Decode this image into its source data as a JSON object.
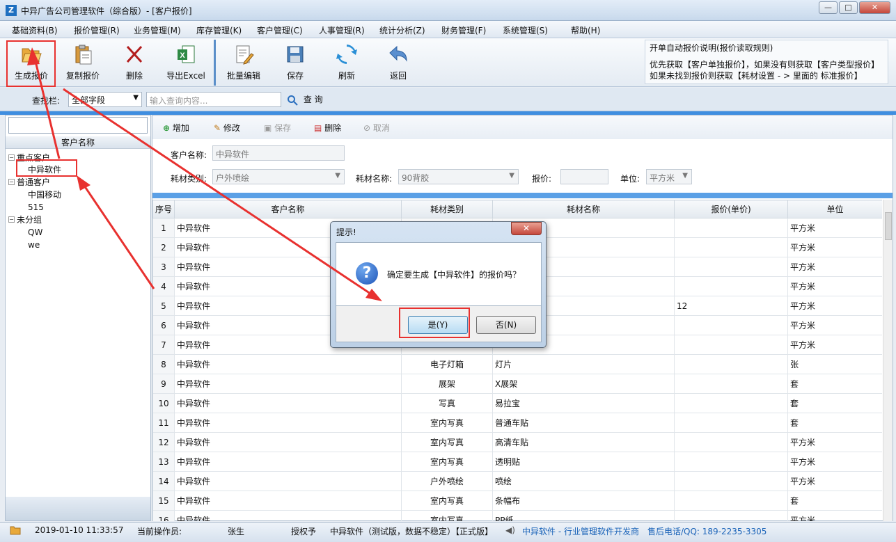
{
  "window": {
    "title": "中异广告公司管理软件（综合版）- [客户报价]",
    "icon": "Z",
    "min_glyph": "—",
    "max_glyph": "□",
    "close_glyph": "✕"
  },
  "menu": [
    "基础资料(B)",
    "报价管理(R)",
    "业务管理(M)",
    "库存管理(K)",
    "客户管理(C)",
    "人事管理(R)",
    "统计分析(Z)",
    "财务管理(F)",
    "系统管理(S)",
    "帮助(H)"
  ],
  "toolbar": {
    "generate_quote": "生成报价",
    "copy_quote": "复制报价",
    "delete": "删除",
    "export_excel": "导出Excel",
    "batch_edit": "批量编辑",
    "save": "保存",
    "refresh": "刷新",
    "back": "返回"
  },
  "info_box": {
    "title": "开单自动报价说明(报价读取规则)",
    "line1": "优先获取【客户单独报价】，如果没有则获取【客户类型报价】",
    "line2": "如果未找到报价则获取【耗材设置 - > 里面的 标准报价】"
  },
  "search": {
    "label": "查找栏:",
    "field_value": "全部字段",
    "placeholder": "输入查询内容...",
    "button": "查 询"
  },
  "tree": {
    "header": "客户名称",
    "groups": [
      {
        "label": "重点客户",
        "children": [
          "中异软件"
        ]
      },
      {
        "label": "普通客户",
        "children": [
          "中国移动",
          "515"
        ]
      },
      {
        "label": "未分组",
        "children": [
          "QW",
          "we"
        ]
      }
    ]
  },
  "actions": {
    "add": "增加",
    "edit": "修改",
    "save": "保存",
    "delete": "删除",
    "cancel": "取消"
  },
  "form": {
    "customer_label": "客户名称:",
    "customer_value": "中异软件",
    "material_type_label": "耗材类别:",
    "material_type_value": "户外喷绘",
    "material_name_label": "耗材名称:",
    "material_name_value": "90背胶",
    "price_label": "报价:",
    "price_value": "",
    "unit_label": "单位:",
    "unit_value": "平方米"
  },
  "grid": {
    "columns": [
      "序号",
      "客户名称",
      "耗材类别",
      "耗材名称",
      "报价(单价)",
      "单位"
    ],
    "rows": [
      [
        "1",
        "中异软件",
        "",
        "",
        "",
        "平方米"
      ],
      [
        "2",
        "中异软件",
        "",
        "",
        "",
        "平方米"
      ],
      [
        "3",
        "中异软件",
        "",
        "",
        "",
        "平方米"
      ],
      [
        "4",
        "中异软件",
        "",
        "",
        "",
        "平方米"
      ],
      [
        "5",
        "中异软件",
        "",
        "",
        "12",
        "平方米"
      ],
      [
        "6",
        "中异软件",
        "",
        "",
        "",
        "平方米"
      ],
      [
        "7",
        "中异软件",
        "",
        "",
        "",
        "平方米"
      ],
      [
        "8",
        "中异软件",
        "电子灯箱",
        "灯片",
        "",
        "张"
      ],
      [
        "9",
        "中异软件",
        "展架",
        "X展架",
        "",
        "套"
      ],
      [
        "10",
        "中异软件",
        "写真",
        "易拉宝",
        "",
        "套"
      ],
      [
        "11",
        "中异软件",
        "室内写真",
        "普通车贴",
        "",
        "套"
      ],
      [
        "12",
        "中异软件",
        "室内写真",
        "高清车贴",
        "",
        "平方米"
      ],
      [
        "13",
        "中异软件",
        "室内写真",
        "透明贴",
        "",
        "平方米"
      ],
      [
        "14",
        "中异软件",
        "户外喷绘",
        "喷绘",
        "",
        "平方米"
      ],
      [
        "15",
        "中异软件",
        "室内写真",
        "条幅布",
        "",
        "套"
      ],
      [
        "16",
        "中异软件",
        "室内写真",
        "PP纸",
        "",
        "平方米"
      ]
    ]
  },
  "dialog": {
    "title": "提示!",
    "message": "确定要生成【中异软件】的报价吗？",
    "yes": "是(Y)",
    "no": "否(N)",
    "close": "✕"
  },
  "status": {
    "datetime": "2019-01-10 11:33:57",
    "operator_label": "当前操作员:",
    "operator": "张生",
    "license_label": "授权予",
    "licensee": "中异软件（测试版，数据不稳定）【正式版】",
    "vendor": "中异软件 - 行业管理软件开发商",
    "support": "售后电话/QQ:  189-2235-3305"
  },
  "colors": {
    "accent": "#3f8ee0",
    "annotation": "#e8312f",
    "status_link": "#1a63b8"
  }
}
